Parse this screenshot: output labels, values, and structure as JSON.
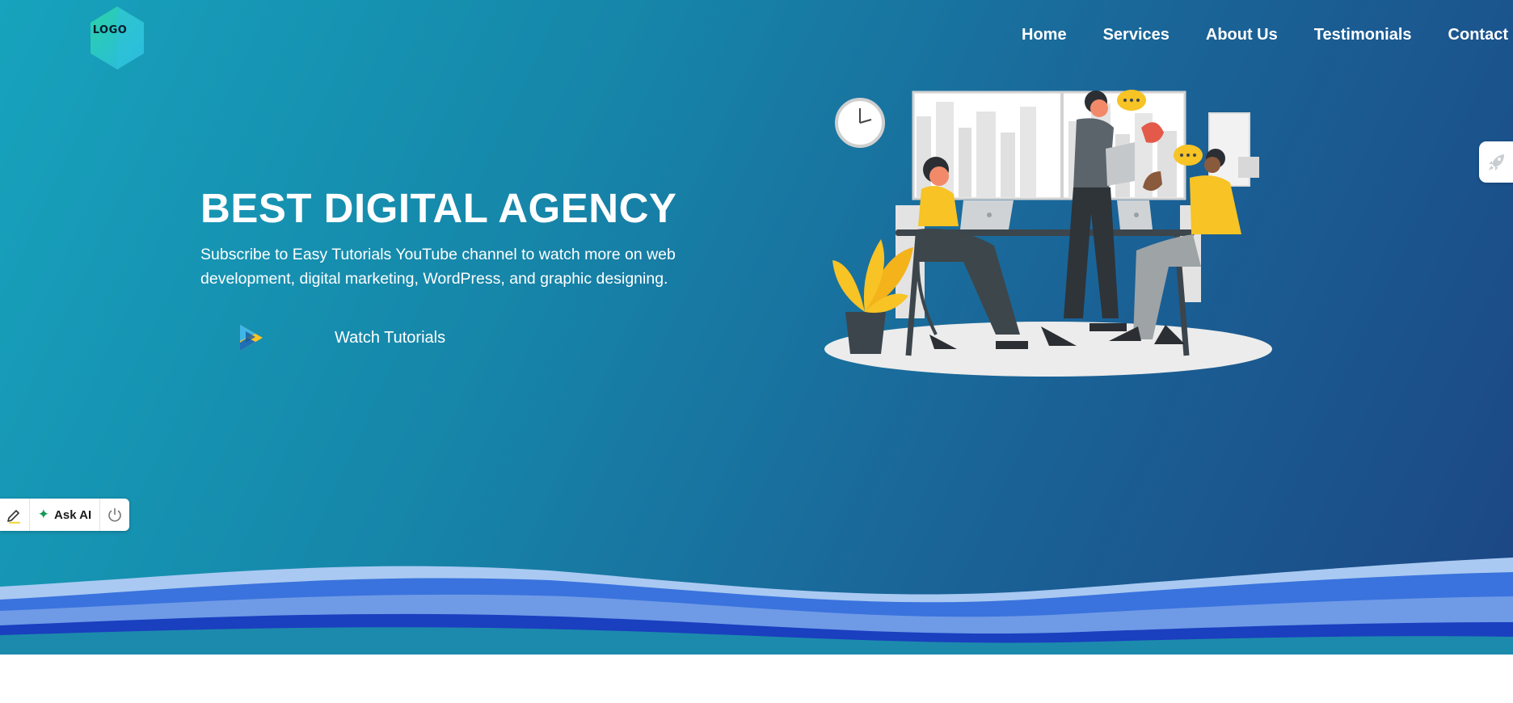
{
  "brand": {
    "logo_text": "LOGO"
  },
  "nav": {
    "items": [
      {
        "label": "Home"
      },
      {
        "label": "Services"
      },
      {
        "label": "About Us"
      },
      {
        "label": "Testimonials"
      },
      {
        "label": "Contact"
      }
    ]
  },
  "hero": {
    "title": "BEST DIGITAL AGENCY",
    "subtitle": "Subscribe to Easy Tutorials YouTube channel to watch more on web development, digital marketing, WordPress, and graphic designing.",
    "cta": {
      "label": "Watch Tutorials",
      "icon": "play-icon"
    }
  },
  "floating_tab": {
    "icon": "rocket-icon"
  },
  "toolbar": {
    "highlight_icon": "highlighter-icon",
    "ask_ai_label": "Ask AI",
    "ask_ai_icon": "sparkle-icon",
    "power_icon": "power-icon"
  },
  "colors": {
    "hero_gradient_start": "#17a3bd",
    "hero_gradient_end": "#1c4684",
    "wave_light": "#a9c9f2",
    "wave_mid": "#3a73dd",
    "wave_dark": "#1a3fbf",
    "accent_yellow": "#f7c325",
    "ai_green": "#169a55"
  }
}
